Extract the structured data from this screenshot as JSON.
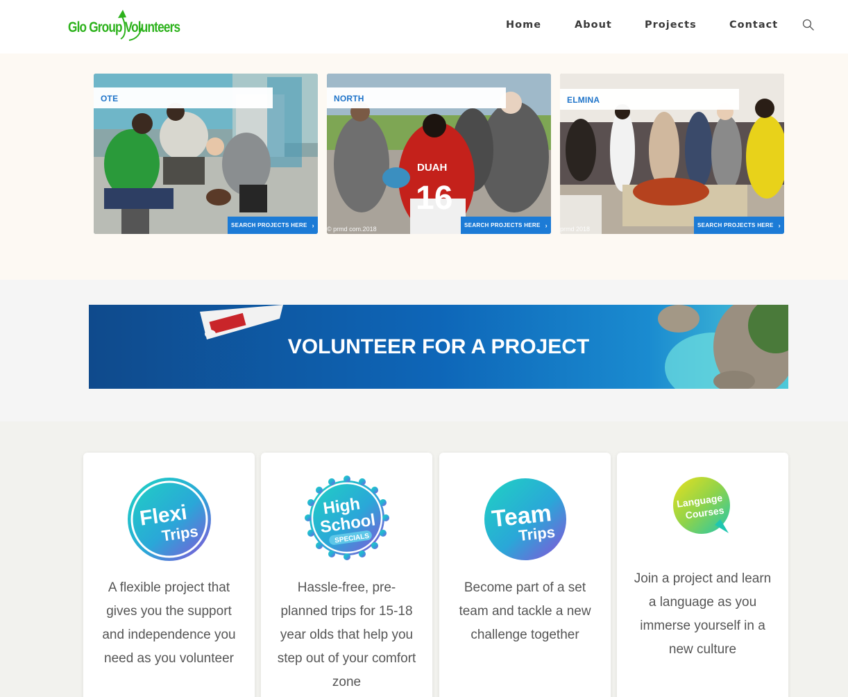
{
  "header": {
    "logo_text": "Glo Group Volunteers",
    "nav": [
      {
        "label": "Home"
      },
      {
        "label": "About"
      },
      {
        "label": "Projects"
      },
      {
        "label": "Contact"
      }
    ],
    "search_icon": "search-icon"
  },
  "projects": [
    {
      "label": "OTE",
      "button": "SEARCH PROJECTS HERE"
    },
    {
      "label": "NORTH",
      "button": "SEARCH PROJECTS HERE",
      "watermark": "© prmd com.2018",
      "jersey_name": "DUAH",
      "jersey_number": "16"
    },
    {
      "label": "ELMINA",
      "button": "SEARCH PROJECTS HERE",
      "watermark": "prmd 2018"
    }
  ],
  "banner": {
    "title": "VOLUNTEER FOR A PROJECT"
  },
  "trip_types": [
    {
      "badge_line1": "Flexi",
      "badge_line2": "Trips",
      "description": "A flexible project that gives you the support and independence you need as you volunteer"
    },
    {
      "badge_line1": "High",
      "badge_line2": "School",
      "badge_line3": "SPECIALS",
      "description": "Hassle-free, pre-planned trips for 15-18 year olds that help you step out of your comfort zone"
    },
    {
      "badge_line1": "Team",
      "badge_line2": "Trips",
      "description": "Become part of a set team and tackle a new challenge together"
    },
    {
      "badge_line1": "Language",
      "badge_line2": "Courses",
      "description": "Join a project and learn a language as you immerse yourself in a new culture"
    }
  ],
  "colors": {
    "logo_green": "#2db21c",
    "accent_blue": "#1c7bd6",
    "label_blue": "#1f74c9"
  }
}
